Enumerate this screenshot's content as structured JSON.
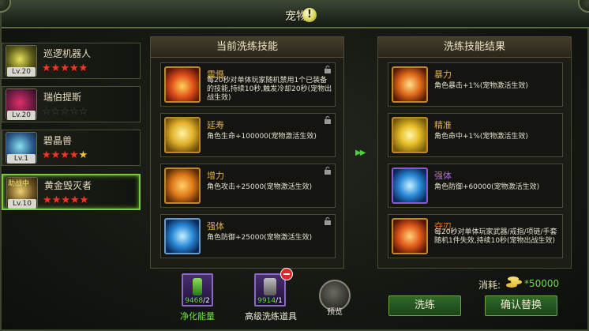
{
  "window": {
    "title": "宠物"
  },
  "pets": [
    {
      "name": "巡逻机器人",
      "level": "Lv.20",
      "stars": [
        "red",
        "red",
        "red",
        "red",
        "red"
      ],
      "tag": ""
    },
    {
      "name": "瑞伯提斯",
      "level": "Lv.20",
      "stars": [
        "empty",
        "empty",
        "empty",
        "empty",
        "empty"
      ],
      "tag": ""
    },
    {
      "name": "碧晶兽",
      "level": "Lv.1",
      "stars": [
        "red",
        "red",
        "red",
        "red",
        "gold"
      ],
      "tag": ""
    },
    {
      "name": "黄金毁灭者",
      "level": "Lv.10",
      "stars": [
        "red",
        "red",
        "red",
        "red",
        "red"
      ],
      "tag": "助战中"
    }
  ],
  "current_panel": {
    "title": "当前洗练技能",
    "skills": [
      {
        "name": "震慑",
        "desc": "每20秒对单体玩家随机禁用1个已装备的技能,持续10秒,触发冷却20秒(宠物出战生效)",
        "icon": "flame-fist-icon"
      },
      {
        "name": "延寿",
        "desc": "角色生命+100000(宠物激活生效)",
        "icon": "heart-aura-icon"
      },
      {
        "name": "增力",
        "desc": "角色攻击+25000(宠物激活生效)",
        "icon": "crossed-swords-icon"
      },
      {
        "name": "强体",
        "desc": "角色防御+25000(宠物激活生效)",
        "icon": "shield-icon"
      }
    ]
  },
  "result_panel": {
    "title": "洗练技能结果",
    "skills": [
      {
        "name": "暴力",
        "desc": "角色暴击+1%(宠物激活生效)",
        "icon": "sword-icon"
      },
      {
        "name": "精准",
        "desc": "角色命中+1%(宠物激活生效)",
        "icon": "target-icon"
      },
      {
        "name": "强体",
        "desc": "角色防御+60000(宠物激活生效)",
        "icon": "shield-icon"
      },
      {
        "name": "夺刃",
        "desc": "每20秒对单体玩家武器/戒指/项链/手套随机1件失效,持续10秒(宠物出战生效)",
        "icon": "disarm-icon"
      }
    ]
  },
  "items": [
    {
      "label": "净化能量",
      "have": "9468",
      "need": "/2"
    },
    {
      "label": "高级洗练道具",
      "have": "9914",
      "need": "/1"
    }
  ],
  "preview_label": "预览",
  "cost": {
    "label": "消耗:",
    "value": "*50000"
  },
  "buttons": {
    "refine": "洗练",
    "confirm": "确认替换"
  }
}
